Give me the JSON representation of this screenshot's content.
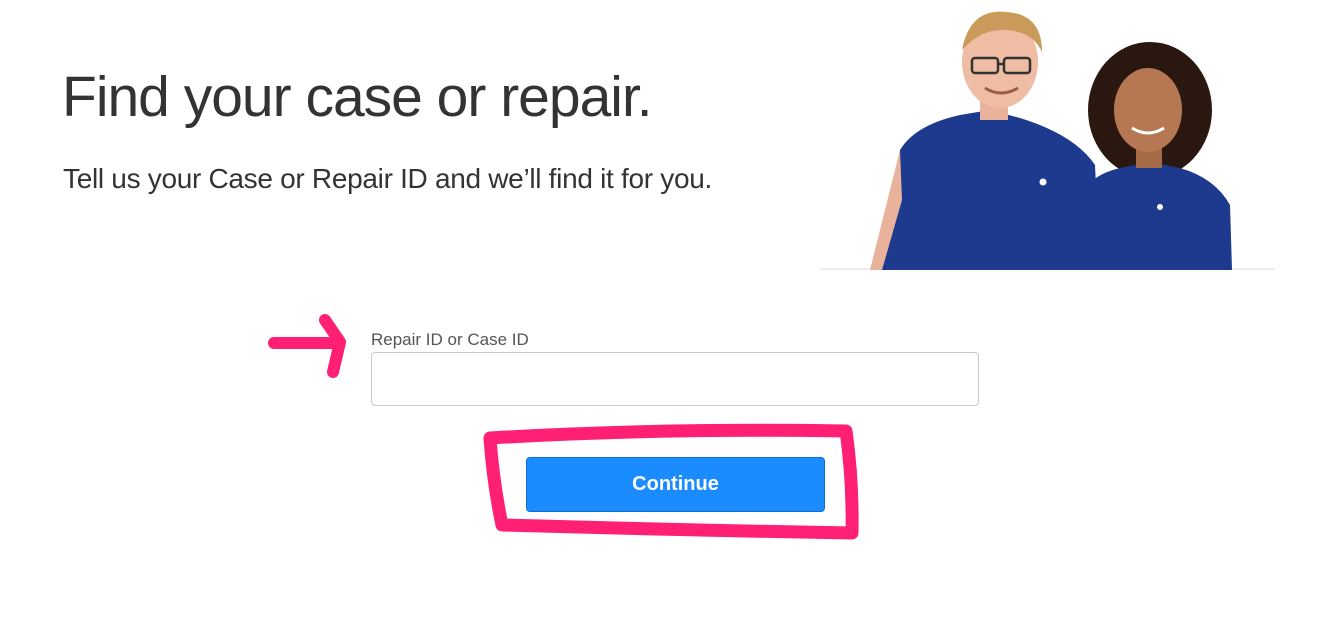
{
  "hero": {
    "title": "Find your case or repair.",
    "subtitle": "Tell us your Case or Repair ID and we’ll find it for you."
  },
  "form": {
    "field_label": "Repair ID or Case ID",
    "field_value": "",
    "continue_label": "Continue"
  },
  "colors": {
    "accent": "#1a8cff",
    "annotation": "#ff1f74",
    "shirt": "#1e3a8f"
  }
}
